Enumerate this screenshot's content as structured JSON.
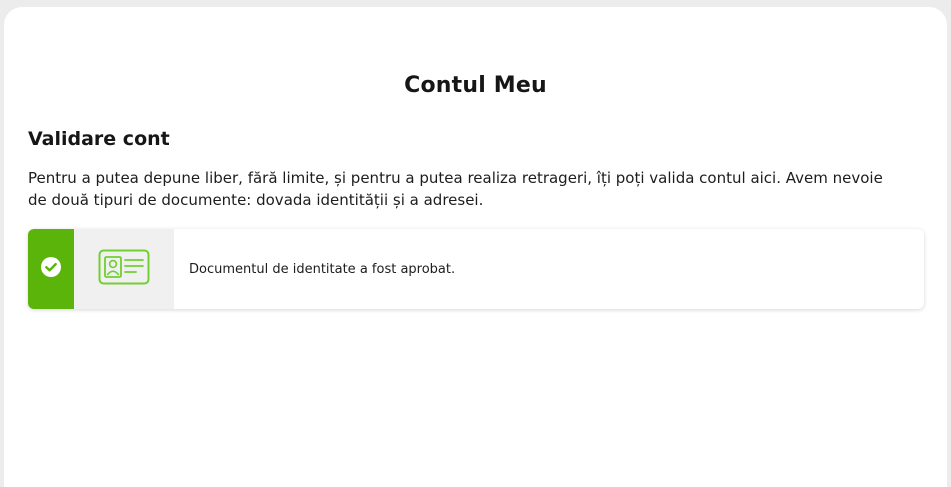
{
  "page": {
    "title": "Contul Meu"
  },
  "validation": {
    "title": "Validare cont",
    "description": "Pentru a putea depune liber, fără limite, și pentru a putea realiza retrageri, îți poți valida contul aici. Avem nevoie de două tipuri de documente: dovada identității și a adresei."
  },
  "documents": [
    {
      "status": "approved",
      "icon": "id-card-icon",
      "status_icon": "check-circle-icon",
      "message": "Documentul de identitate a fost aprobat."
    }
  ],
  "colors": {
    "accent_green": "#5bb40a",
    "icon_green": "#6fcf2f",
    "icon_box_bg": "#f0f0f0",
    "page_bg": "#ececec"
  }
}
